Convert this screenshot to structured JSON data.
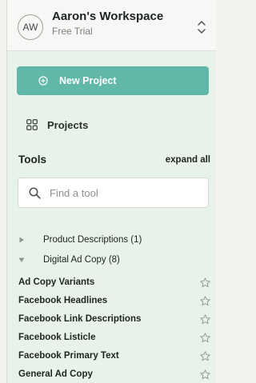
{
  "workspace": {
    "avatar_initials": "AW",
    "name": "Aaron's Workspace",
    "plan": "Free Trial"
  },
  "actions": {
    "new_project_label": "New Project",
    "projects_label": "Projects"
  },
  "tools": {
    "title": "Tools",
    "expand_all_label": "expand all",
    "search_placeholder": "Find a tool",
    "categories": [
      {
        "label": "Product Descriptions (1)",
        "expanded": false
      },
      {
        "label": "Digital Ad Copy (8)",
        "expanded": true
      }
    ],
    "items": [
      {
        "label": "Ad Copy Variants"
      },
      {
        "label": "Facebook Headlines"
      },
      {
        "label": "Facebook Link Descriptions"
      },
      {
        "label": "Facebook Listicle"
      },
      {
        "label": "Facebook Primary Text"
      },
      {
        "label": "General Ad Copy"
      }
    ]
  },
  "colors": {
    "accent": "#62b8a8",
    "sidebar_bg": "#e6f2ea",
    "header_bg": "#f7f7f5",
    "icon_muted": "#8d958f"
  },
  "icons": {
    "workspace_toggle": "chevron-up-down-icon",
    "new_project": "plus-circle-icon",
    "projects": "grid-icon",
    "search": "search-icon",
    "collapsed": "caret-right-icon",
    "expanded": "caret-down-icon",
    "favorite": "star-outline-icon"
  }
}
